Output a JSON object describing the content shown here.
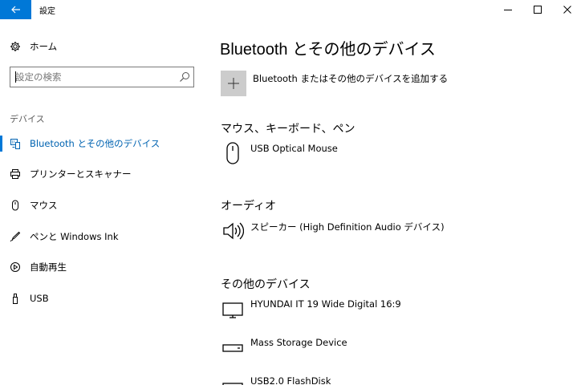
{
  "window": {
    "title": "設定"
  },
  "sidebar": {
    "home_label": "ホーム",
    "search_placeholder": "設定の検索",
    "section_label": "デバイス",
    "items": [
      {
        "label": "Bluetooth とその他のデバイス",
        "icon": "bluetooth-devices-icon",
        "active": true
      },
      {
        "label": "プリンターとスキャナー",
        "icon": "printer-icon",
        "active": false
      },
      {
        "label": "マウス",
        "icon": "mouse-icon",
        "active": false
      },
      {
        "label": "ペンと Windows Ink",
        "icon": "pen-icon",
        "active": false
      },
      {
        "label": "自動再生",
        "icon": "autoplay-icon",
        "active": false
      },
      {
        "label": "USB",
        "icon": "usb-icon",
        "active": false
      }
    ]
  },
  "main": {
    "title": "Bluetooth とその他のデバイス",
    "add_device_label": "Bluetooth またはその他のデバイスを追加する",
    "groups": [
      {
        "heading": "マウス、キーボード、ペン",
        "devices": [
          {
            "name": "USB Optical Mouse",
            "icon": "mouse-icon"
          }
        ]
      },
      {
        "heading": "オーディオ",
        "devices": [
          {
            "name": "スピーカー (High Definition Audio デバイス)",
            "icon": "speaker-icon"
          }
        ]
      },
      {
        "heading": "その他のデバイス",
        "devices": [
          {
            "name": "HYUNDAI IT 19 Wide Digital 16:9",
            "icon": "monitor-icon"
          },
          {
            "name": "Mass Storage Device",
            "icon": "drive-icon"
          },
          {
            "name": "USB2.0 FlashDisk",
            "icon": "drive-icon"
          }
        ]
      }
    ]
  },
  "colors": {
    "accent": "#0078d7",
    "active_text": "#0063b1",
    "add_button_bg": "#cccccc"
  }
}
